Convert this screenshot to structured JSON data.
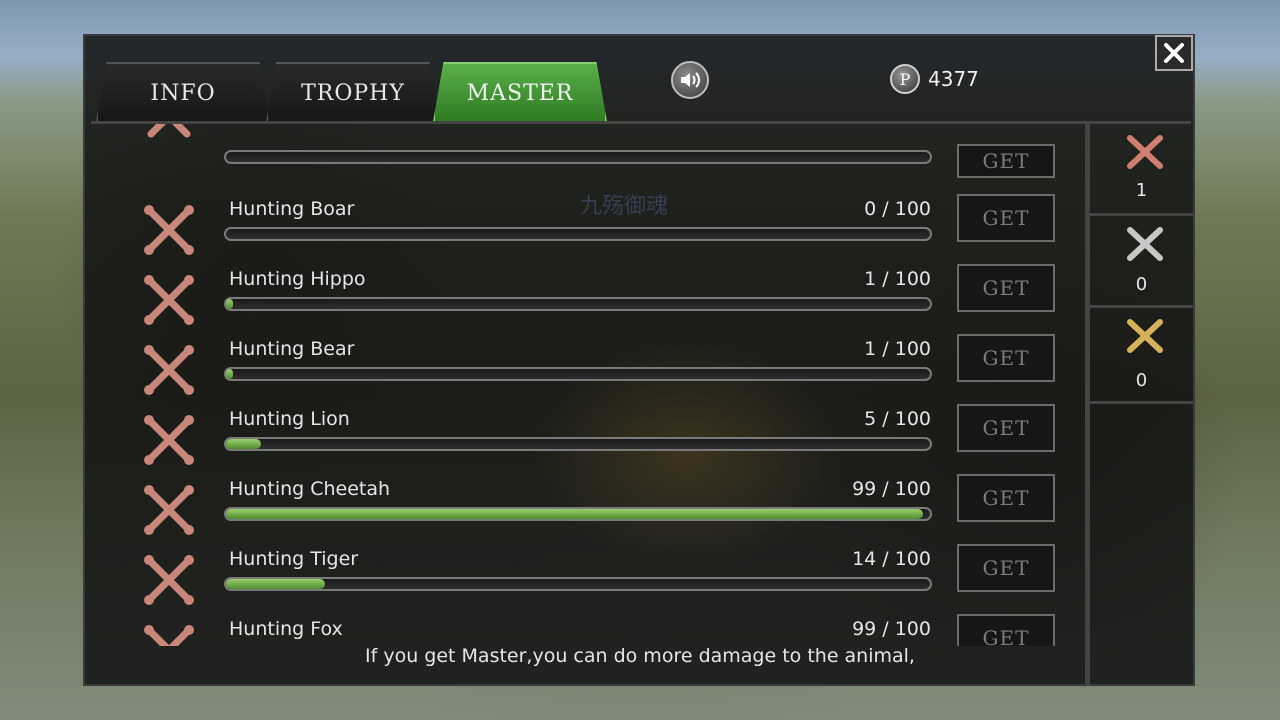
{
  "tabs": [
    {
      "label": "INFO",
      "active": false
    },
    {
      "label": "TROPHY",
      "active": false
    },
    {
      "label": "MASTER",
      "active": true
    }
  ],
  "points": {
    "symbol": "P",
    "value": "4377"
  },
  "watermark": "九殇御魂",
  "masteries": [
    {
      "name": "Hunting Boar",
      "progress": "0 / 100",
      "current": 0,
      "max": 100,
      "button": "GET",
      "bone_color": "#c8877a"
    },
    {
      "name": "Hunting Hippo",
      "progress": "1 / 100",
      "current": 1,
      "max": 100,
      "button": "GET",
      "bone_color": "#c8877a"
    },
    {
      "name": "Hunting Bear",
      "progress": "1 / 100",
      "current": 1,
      "max": 100,
      "button": "GET",
      "bone_color": "#c8877a"
    },
    {
      "name": "Hunting Lion",
      "progress": "5 / 100",
      "current": 5,
      "max": 100,
      "button": "GET",
      "bone_color": "#c8877a"
    },
    {
      "name": "Hunting Cheetah",
      "progress": "99 / 100",
      "current": 99,
      "max": 100,
      "button": "GET",
      "bone_color": "#c8877a"
    },
    {
      "name": "Hunting Tiger",
      "progress": "14 / 100",
      "current": 14,
      "max": 100,
      "button": "GET",
      "bone_color": "#c8877a"
    },
    {
      "name": "Hunting Fox",
      "progress": "99 / 100",
      "current": 99,
      "max": 100,
      "button": "GET",
      "bone_color": "#c8877a"
    }
  ],
  "top_partial_row": {
    "button": "GET"
  },
  "tiers": [
    {
      "color": "#d08070",
      "count": "1"
    },
    {
      "color": "#c8c8c8",
      "count": "0"
    },
    {
      "color": "#d6b15c",
      "count": "0"
    }
  ],
  "footer": "If you get Master,you can do more damage to the animal,"
}
